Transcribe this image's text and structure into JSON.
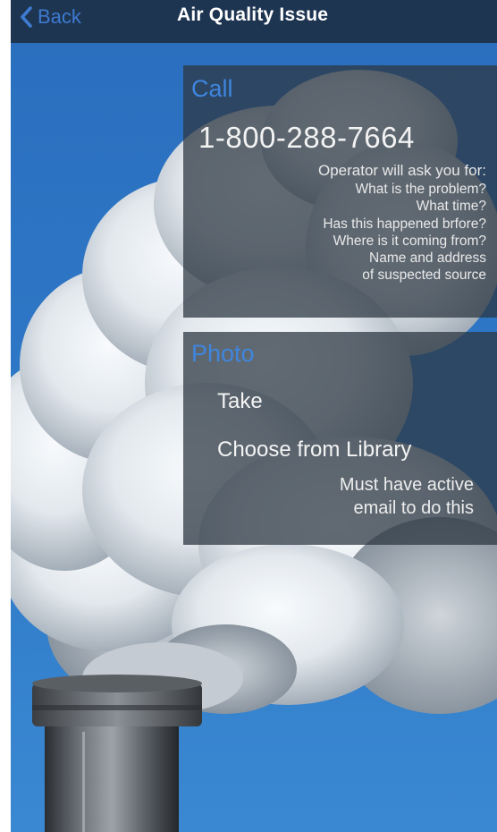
{
  "nav": {
    "back_label": "Back",
    "title": "Air Quality Issue"
  },
  "call": {
    "heading": "Call",
    "phone": "1-800-288-7664",
    "operator_lines": [
      "Operator will ask you for:",
      "What is the problem?",
      "What time?",
      "Has this happened brfore?",
      "Where is it coming from?",
      "Name and address",
      "of suspected source"
    ]
  },
  "photo": {
    "heading": "Photo",
    "take_label": "Take",
    "library_label": "Choose from Library",
    "note_lines": [
      "Must have active",
      "email to do this"
    ]
  },
  "colors": {
    "nav_background": "#1e3552",
    "accent_blue": "#3f86de",
    "panel_background": "rgba(45,55,66,0.74)",
    "sky_blue": "#2f78c4"
  },
  "background_image": "industrial-smokestack-with-white-smoke"
}
